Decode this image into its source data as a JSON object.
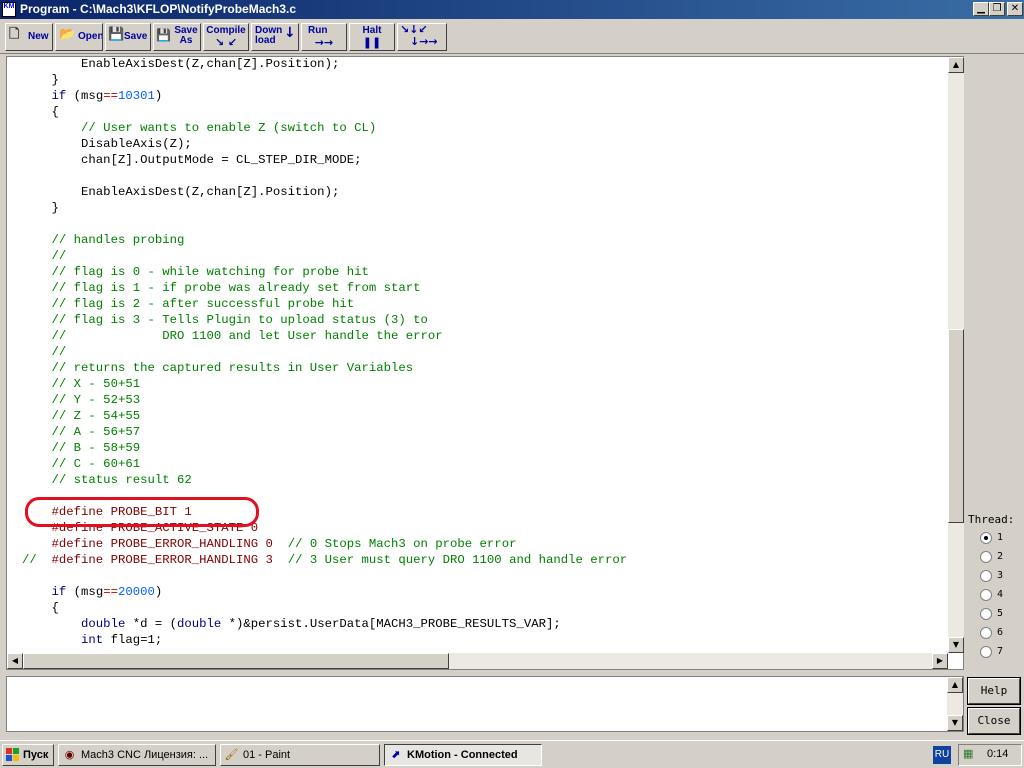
{
  "window": {
    "title": "Program - C:\\Mach3\\KFLOP\\NotifyProbeMach3.c",
    "app_icon_text": "KM",
    "minimize_icon": "minimize-icon",
    "restore_icon": "restore-icon",
    "close_icon": "close-icon"
  },
  "toolbar": {
    "new": "New",
    "open": "Open",
    "save": "Save",
    "save_as_1": "Save",
    "save_as_2": "As",
    "compile": "Compile",
    "download_1": "Down",
    "download_2": "load",
    "run": "Run",
    "halt": "Halt"
  },
  "code": [
    {
      "indent": "        ",
      "parts": [
        [
          "",
          "EnableAxisDest(Z,chan[Z].Position);"
        ]
      ]
    },
    {
      "indent": "    ",
      "parts": [
        [
          "",
          "}"
        ]
      ]
    },
    {
      "indent": "    ",
      "parts": [
        [
          "kw",
          "if"
        ],
        [
          "",
          " (msg"
        ],
        [
          "op",
          "=="
        ],
        [
          "num",
          "10301"
        ],
        [
          "",
          ")"
        ]
      ]
    },
    {
      "indent": "    ",
      "parts": [
        [
          "",
          "{"
        ]
      ]
    },
    {
      "indent": "        ",
      "parts": [
        [
          "cmt",
          "// User wants to enable Z (switch to CL)"
        ]
      ]
    },
    {
      "indent": "        ",
      "parts": [
        [
          "",
          "DisableAxis(Z);"
        ]
      ]
    },
    {
      "indent": "        ",
      "parts": [
        [
          "",
          "chan[Z].OutputMode = CL_STEP_DIR_MODE;"
        ]
      ]
    },
    {
      "indent": "",
      "parts": []
    },
    {
      "indent": "        ",
      "parts": [
        [
          "",
          "EnableAxisDest(Z,chan[Z].Position);"
        ]
      ]
    },
    {
      "indent": "    ",
      "parts": [
        [
          "",
          "}"
        ]
      ]
    },
    {
      "indent": "",
      "parts": []
    },
    {
      "indent": "    ",
      "parts": [
        [
          "cmt",
          "// handles probing"
        ]
      ]
    },
    {
      "indent": "    ",
      "parts": [
        [
          "cmt",
          "//"
        ]
      ]
    },
    {
      "indent": "    ",
      "parts": [
        [
          "cmt",
          "// flag is 0 - while watching for probe hit"
        ]
      ]
    },
    {
      "indent": "    ",
      "parts": [
        [
          "cmt",
          "// flag is 1 - if probe was already set from start"
        ]
      ]
    },
    {
      "indent": "    ",
      "parts": [
        [
          "cmt",
          "// flag is 2 - after successful probe hit"
        ]
      ]
    },
    {
      "indent": "    ",
      "parts": [
        [
          "cmt",
          "// flag is 3 - Tells Plugin to upload status (3) to"
        ]
      ]
    },
    {
      "indent": "    ",
      "parts": [
        [
          "cmt",
          "//             DRO 1100 and let User handle the error"
        ]
      ]
    },
    {
      "indent": "    ",
      "parts": [
        [
          "cmt",
          "//"
        ]
      ]
    },
    {
      "indent": "    ",
      "parts": [
        [
          "cmt",
          "// returns the captured results in User Variables"
        ]
      ]
    },
    {
      "indent": "    ",
      "parts": [
        [
          "cmt",
          "// X - 50+51"
        ]
      ]
    },
    {
      "indent": "    ",
      "parts": [
        [
          "cmt",
          "// Y - 52+53"
        ]
      ]
    },
    {
      "indent": "    ",
      "parts": [
        [
          "cmt",
          "// Z - 54+55"
        ]
      ]
    },
    {
      "indent": "    ",
      "parts": [
        [
          "cmt",
          "// A - 56+57"
        ]
      ]
    },
    {
      "indent": "    ",
      "parts": [
        [
          "cmt",
          "// B - 58+59"
        ]
      ]
    },
    {
      "indent": "    ",
      "parts": [
        [
          "cmt",
          "// C - 60+61"
        ]
      ]
    },
    {
      "indent": "    ",
      "parts": [
        [
          "cmt",
          "// status result 62"
        ]
      ]
    },
    {
      "indent": "",
      "parts": []
    },
    {
      "indent": "    ",
      "parts": [
        [
          "pp",
          "#define PROBE_BIT 1"
        ]
      ]
    },
    {
      "indent": "    ",
      "parts": [
        [
          "pp",
          "#define PROBE_ACTIVE_STATE 0"
        ]
      ]
    },
    {
      "indent": "    ",
      "parts": [
        [
          "pp",
          "#define PROBE_ERROR_HANDLING 0"
        ],
        [
          "",
          "  "
        ],
        [
          "cmt",
          "// 0 Stops Mach3 on probe error"
        ]
      ]
    },
    {
      "indent": "",
      "parts": [
        [
          "cmt",
          "//  "
        ],
        [
          "pp",
          "#define PROBE_ERROR_HANDLING 3"
        ],
        [
          "",
          "  "
        ],
        [
          "cmt",
          "// 3 User must query DRO 1100 and handle error"
        ]
      ]
    },
    {
      "indent": "",
      "parts": []
    },
    {
      "indent": "    ",
      "parts": [
        [
          "kw",
          "if"
        ],
        [
          "",
          " (msg"
        ],
        [
          "op",
          "=="
        ],
        [
          "num",
          "20000"
        ],
        [
          "",
          ")"
        ]
      ]
    },
    {
      "indent": "    ",
      "parts": [
        [
          "",
          "{"
        ]
      ]
    },
    {
      "indent": "        ",
      "parts": [
        [
          "kw",
          "double"
        ],
        [
          "",
          " *d = ("
        ],
        [
          "kw",
          "double"
        ],
        [
          "",
          " *)&persist.UserData[MACH3_PROBE_RESULTS_VAR];"
        ]
      ]
    },
    {
      "indent": "        ",
      "parts": [
        [
          "kw",
          "int"
        ],
        [
          "",
          " flag=1;"
        ]
      ]
    }
  ],
  "thread": {
    "label": "Thread:",
    "options": [
      "1",
      "2",
      "3",
      "4",
      "5",
      "6",
      "7"
    ],
    "selected": "1"
  },
  "buttons": {
    "help": "Help",
    "close": "Close"
  },
  "taskbar": {
    "start": "Пуск",
    "tasks": [
      {
        "label": "Mach3 CNC  Лицензия: ...",
        "icon": "mach3-icon"
      },
      {
        "label": "01 - Paint",
        "icon": "paint-icon"
      },
      {
        "label": "KMotion - Connected",
        "icon": "kmotion-icon"
      }
    ],
    "language": "RU",
    "clock": "0:14"
  }
}
